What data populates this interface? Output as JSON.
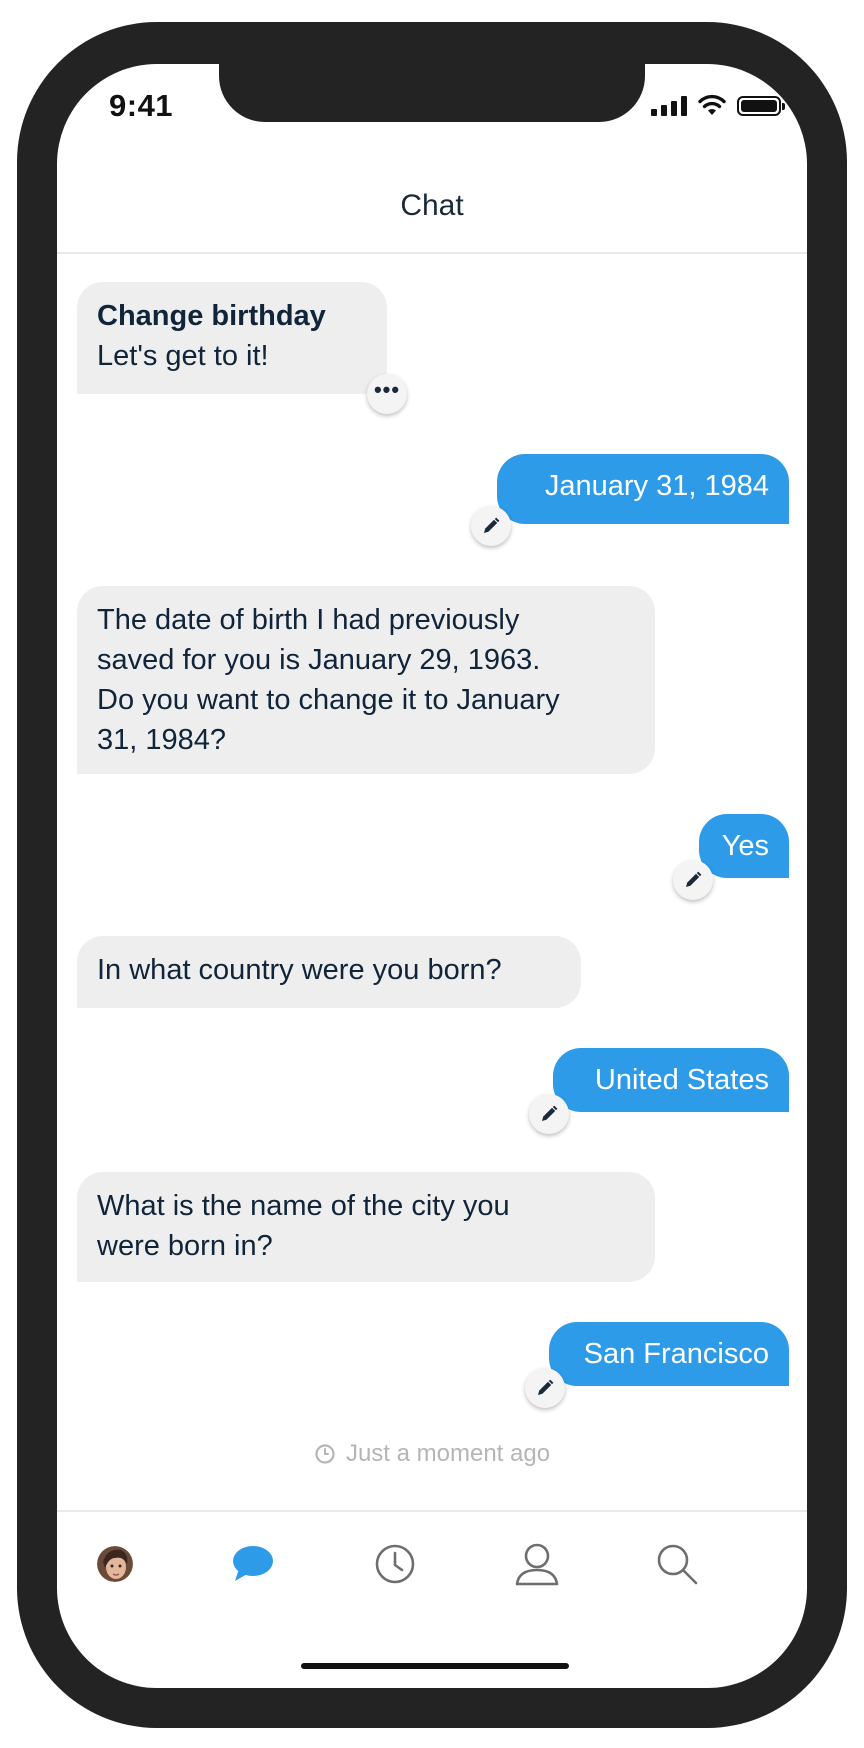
{
  "status_bar": {
    "time": "9:41"
  },
  "header": {
    "title": "Chat"
  },
  "messages": {
    "m1_title": "Change birthday",
    "m1_text": "Let's get to it!",
    "m2": "January 31, 1984",
    "m3_l1": "The date of birth I had previously",
    "m3_l2": "saved for you is January 29, 1963.",
    "m3_l3": "Do you want to change it to January",
    "m3_l4": "31, 1984?",
    "m4": "Yes",
    "m5": "In what country were you born?",
    "m6": "United States",
    "m7_l1": "What is the name of the city you",
    "m7_l2": "were born in?",
    "m8": "San Francisco"
  },
  "timestamp": "Just a moment ago",
  "tabs": [
    "profile-avatar",
    "chat-icon",
    "history-clock-icon",
    "account-person-icon",
    "search-icon"
  ],
  "colors": {
    "accent": "#2d9be8",
    "bot_bubble": "#eeeeee",
    "text_dark": "#10243a",
    "muted": "#b5b5b5"
  }
}
